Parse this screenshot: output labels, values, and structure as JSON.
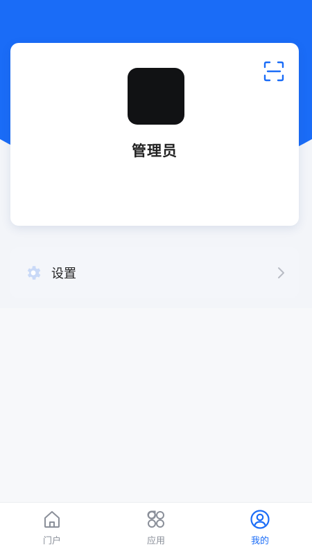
{
  "profile": {
    "name": "管理员",
    "scan_icon": "scan-icon",
    "avatar_color": "#111214"
  },
  "menu": {
    "settings_label": "设置",
    "settings_icon": "gear-icon"
  },
  "tabs": [
    {
      "label": "门户",
      "icon": "home-icon",
      "active": false
    },
    {
      "label": "应用",
      "icon": "apps-icon",
      "active": false
    },
    {
      "label": "我的",
      "icon": "user-icon",
      "active": true
    }
  ],
  "colors": {
    "primary": "#1a6cf7",
    "inactive": "#8a8f99"
  }
}
